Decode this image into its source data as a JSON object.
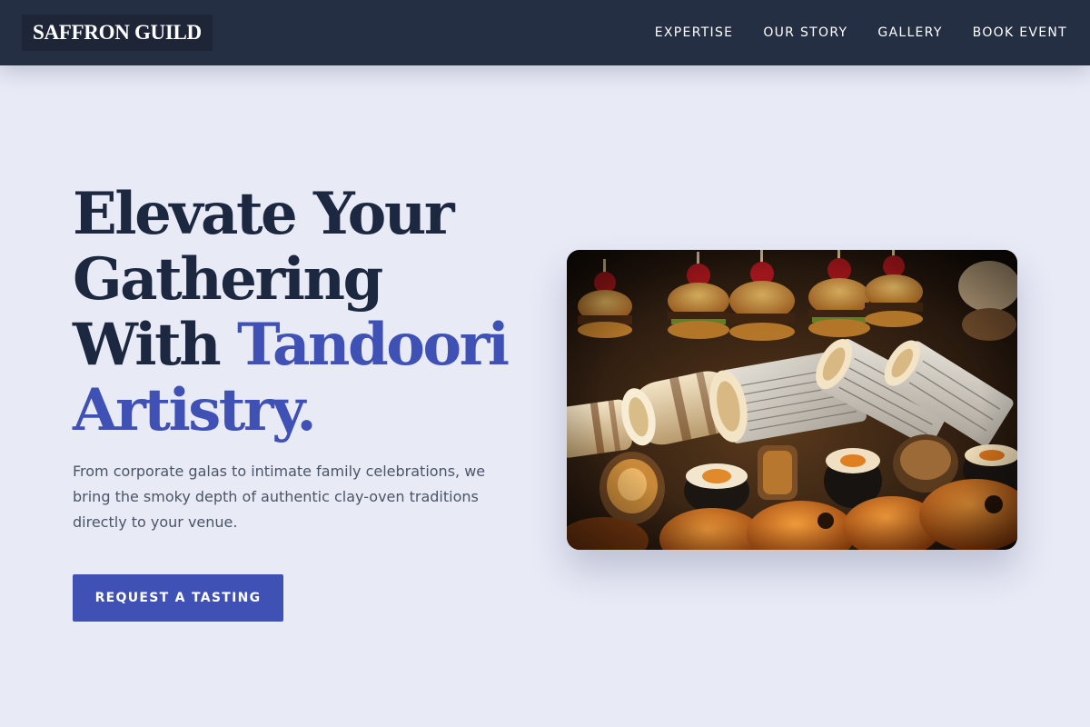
{
  "brand": {
    "name": "SAFFRON GUILD"
  },
  "nav": {
    "links": [
      "EXPERTISE",
      "OUR STORY",
      "GALLERY",
      "BOOK EVENT"
    ]
  },
  "hero": {
    "headline_part1": "Elevate Your Gathering With ",
    "headline_accent": "Tandoori Artistry.",
    "description": "From corporate galas to intimate family celebrations, we bring the smoky depth of authentic clay-oven traditions directly to your venue.",
    "cta_label": "REQUEST A TASTING"
  },
  "colors": {
    "navbar": "#252f44",
    "background": "#e8eaf6",
    "accent": "#3f51b5",
    "heading": "#1c2740",
    "body_text": "#4a5568"
  }
}
